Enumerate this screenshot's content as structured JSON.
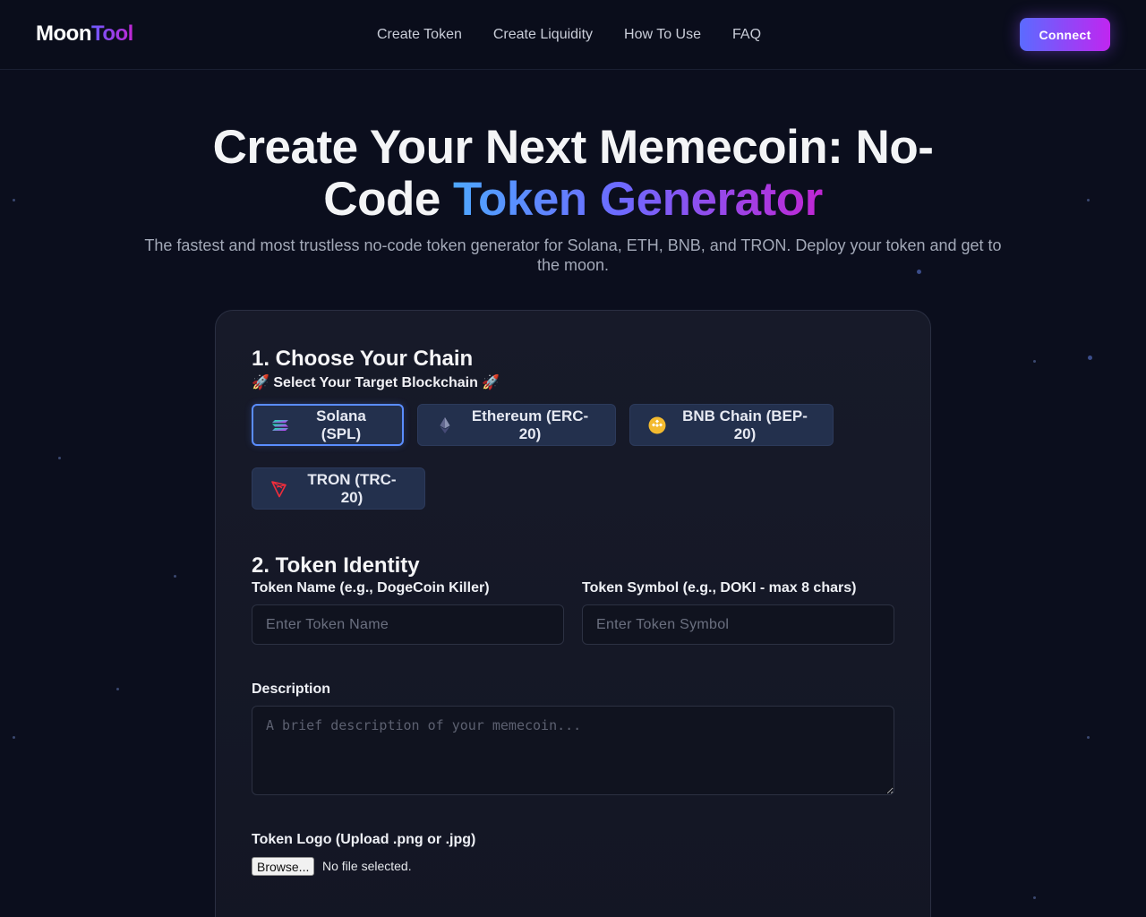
{
  "nav": {
    "logo_part1": "Moon",
    "logo_part2": "Tool",
    "links": [
      "Create Token",
      "Create Liquidity",
      "How To Use",
      "FAQ"
    ],
    "connect_label": "Connect"
  },
  "hero": {
    "title_line1": "Create Your Next Memecoin: No-",
    "title_line2_plain": "Code ",
    "title_line2_gradient": "Token Generator",
    "subtitle": "The fastest and most trustless no-code token generator for Solana, ETH, BNB, and TRON. Deploy your token and get to the moon."
  },
  "step1": {
    "title": "1. Choose Your Chain",
    "subtitle": "🚀 Select Your Target Blockchain 🚀",
    "chains": [
      {
        "label": "Solana (SPL)",
        "icon": "solana-icon",
        "selected": true
      },
      {
        "label": "Ethereum (ERC-20)",
        "icon": "ethereum-icon",
        "selected": false
      },
      {
        "label": "BNB Chain (BEP-20)",
        "icon": "bnb-icon",
        "selected": false
      },
      {
        "label": "TRON (TRC-20)",
        "icon": "tron-icon",
        "selected": false
      }
    ]
  },
  "step2": {
    "title": "2. Token Identity",
    "name_label": "Token Name (e.g., DogeCoin Killer)",
    "name_placeholder": "Enter Token Name",
    "name_value": "",
    "symbol_label": "Token Symbol (e.g., DOKI - max 8 chars)",
    "symbol_placeholder": "Enter Token Symbol",
    "symbol_value": "",
    "description_label": "Description",
    "description_placeholder": "A brief description of your memecoin...",
    "logo_label": "Token Logo (Upload .png or .jpg)",
    "browse_label": "Browse...",
    "file_status": "No file selected."
  },
  "colors": {
    "background": "#0b0e1d",
    "accent_start": "#5b6bff",
    "accent_end": "#c026f0",
    "selected_border": "#5a8dff",
    "chain_button_bg": "#23304d"
  }
}
